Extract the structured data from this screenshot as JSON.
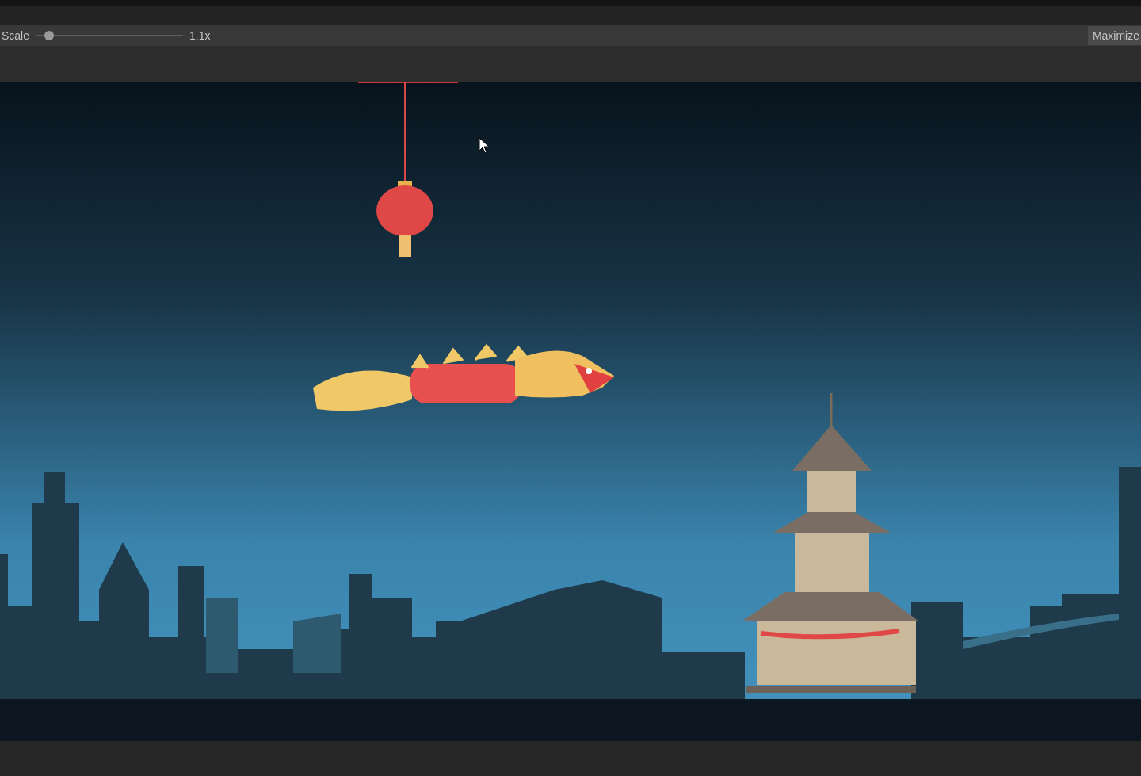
{
  "toolbar": {
    "scale_label": "Scale",
    "scale_slider": {
      "level": 0.09
    },
    "scale_value": "1.1x",
    "maximize_button": "Maximize"
  }
}
